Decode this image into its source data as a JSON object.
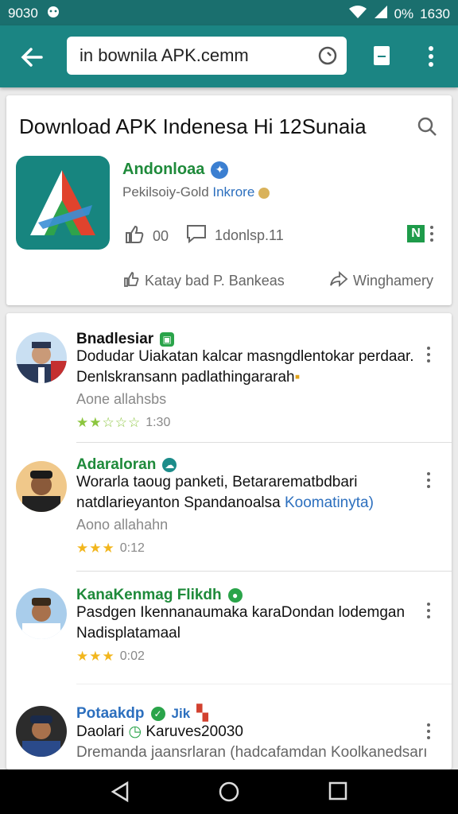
{
  "status_bar": {
    "left_text": "9030",
    "right_text": "1630",
    "battery_text": "0%"
  },
  "toolbar": {
    "url": "in bownila APK.cemm"
  },
  "app": {
    "page_title": "Download APK Indenesa Hi 12Sunaia",
    "name": "Andonloaa",
    "publisher_prefix": "Pekilsoiy-Gold ",
    "publisher_link": "Inkrore",
    "likes": "00",
    "comments": "1donlsp.11",
    "action_left": "Katay bad P. Bankeas",
    "action_right": "Winghamery",
    "colors": {
      "green": "#1e8a3a",
      "blue": "#2c6fbe",
      "teal": "#1b8583"
    }
  },
  "reviews": [
    {
      "name": "Bnadlesiar",
      "line1": "Dodudar Uiakatan kalcar masngdlentokar perdaar.",
      "line2": "Denlskransann padlathingararah",
      "meta": "Aone allahsbs",
      "stars": "★★☆☆☆",
      "time": "1:30"
    },
    {
      "name": "Adaraloran",
      "line1": "Worarla taoug panketi, Betararematbdbari",
      "line2": "natdlarieyanton Spandanoalsa ",
      "line2_link": "Koomatinyta)",
      "meta": "Aono allahahn",
      "stars": "★★★",
      "time": "0:12"
    },
    {
      "name": "KanaKenmag Flikdh",
      "line1": "Pasdgen Ikennanaumaka karaDondan lodemgan",
      "line2": "Nadisplatamaal",
      "stars": "★★★",
      "time": "0:02"
    },
    {
      "name": "Potaakdp",
      "tag": "Jik",
      "line1": "Daolari",
      "line1_b": "Karuves20030",
      "line2": "Dremanda jaansrlaran (hadcafamdan Koolkanedsarı"
    }
  ]
}
